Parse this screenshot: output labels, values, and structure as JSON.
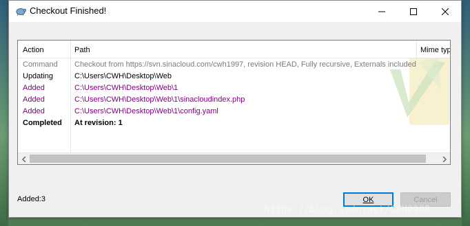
{
  "window": {
    "title": "Checkout Finished!",
    "icon": "tortoisesvn-icon"
  },
  "list": {
    "columns": [
      "Action",
      "Path",
      "Mime typ"
    ],
    "rows": [
      {
        "action": "Command",
        "path": "Checkout from https://svn.sinacloud.com/cwh1997, revision HEAD, Fully recursive, Externals included",
        "style": "gray"
      },
      {
        "action": "Updating",
        "path": "C:\\Users\\CWH\\Desktop\\Web",
        "style": "black"
      },
      {
        "action": "Added",
        "path": "C:\\Users\\CWH\\Desktop\\Web\\1",
        "style": "purple"
      },
      {
        "action": "Added",
        "path": "C:\\Users\\CWH\\Desktop\\Web\\1\\sinacloudindex.php",
        "style": "purple"
      },
      {
        "action": "Added",
        "path": "C:\\Users\\CWH\\Desktop\\Web\\1\\config.yaml",
        "style": "purple"
      },
      {
        "action": "Completed",
        "path": "At revision: 1",
        "style": "bold"
      }
    ]
  },
  "status": {
    "text": "Added:3"
  },
  "buttons": {
    "ok": "OK",
    "cancel": "Cancel"
  },
  "colors": {
    "command": "#7a7a7a",
    "added": "#800080",
    "accent": "#0078d7"
  },
  "overlay": {
    "url": "https://blog.csdn.net/CWH0908"
  }
}
